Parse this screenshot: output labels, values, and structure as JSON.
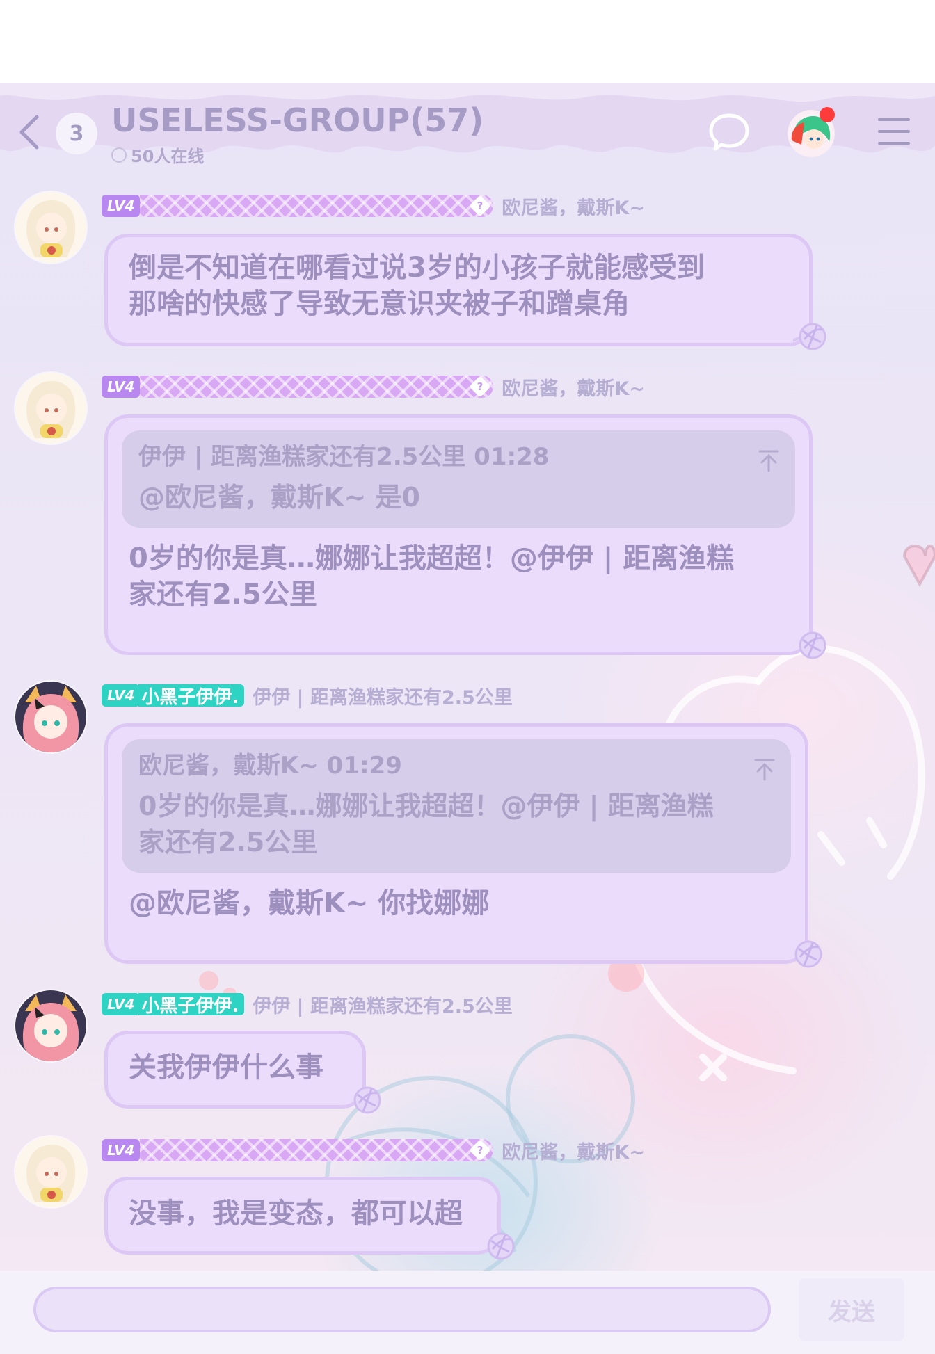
{
  "header": {
    "back_icon": "chevron-left-icon",
    "unread_count": "3",
    "group_title": "USELESS-GROUP(57)",
    "online_text": "50人在线",
    "chat_icon": "chat-bubble-icon",
    "menu_icon": "hamburger-menu-icon"
  },
  "messages": [
    {
      "level": "LV4",
      "nickname": "欧尼酱，戴斯K~",
      "text": "倒是不知道在哪看过说3岁的小孩子就能感受到\n那啥的快感了导致无意识夹被子和蹭桌角"
    },
    {
      "level": "LV4",
      "nickname": "欧尼酱，戴斯K~",
      "quote_header": "伊伊 | 距离渔糕家还有2.5公里 01:28",
      "quote_body": "@欧尼酱，戴斯K~ 是0",
      "text": "0岁的你是真…娜娜让我超超！@伊伊 | 距离渔糕\n家还有2.5公里"
    },
    {
      "level": "LV4",
      "title": "小黑子伊伊.",
      "nickname": "伊伊 | 距离渔糕家还有2.5公里",
      "quote_header": "欧尼酱，戴斯K~ 01:29",
      "quote_body": "0岁的你是真…娜娜让我超超！@伊伊 | 距离渔糕\n家还有2.5公里",
      "text": "@欧尼酱，戴斯K~ 你找娜娜"
    },
    {
      "level": "LV4",
      "title": "小黑子伊伊.",
      "nickname": "伊伊 | 距离渔糕家还有2.5公里",
      "text": "关我伊伊什么事"
    },
    {
      "level": "LV4",
      "nickname": "欧尼酱，戴斯K~",
      "text": "没事，我是变态，都可以超"
    }
  ],
  "composer": {
    "placeholder": "",
    "send_label": "发送"
  },
  "colors": {
    "accent_purple": "#b888f0",
    "accent_teal": "#2ed3c4",
    "bubble_fill": "#ecdcfb",
    "text_main": "#9d8fbe",
    "notification": "#ff3b3b"
  }
}
